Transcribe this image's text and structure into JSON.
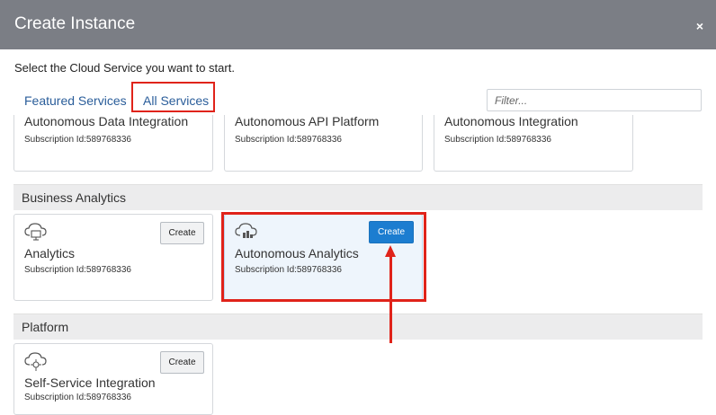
{
  "dialog": {
    "title": "Create Instance",
    "close_label": "×",
    "instruction": "Select the Cloud Service you want to start."
  },
  "tabs": [
    {
      "label": "Featured Services",
      "active": false
    },
    {
      "label": "All Services",
      "active": true
    }
  ],
  "filter": {
    "placeholder": "Filter...",
    "value": ""
  },
  "top_row": [
    {
      "name": "Autonomous Data Integration",
      "subscription": "Subscription Id:589768336"
    },
    {
      "name": "Autonomous API Platform",
      "subscription": "Subscription Id:589768336"
    },
    {
      "name": "Autonomous Integration",
      "subscription": "Subscription Id:589768336"
    }
  ],
  "sections": [
    {
      "title": "Business Analytics",
      "services": [
        {
          "name": "Analytics",
          "subscription": "Subscription Id:589768336",
          "button": "Create",
          "icon": "cloud-monitor-icon"
        },
        {
          "name": "Autonomous Analytics",
          "subscription": "Subscription Id:589768336",
          "button": "Create",
          "icon": "cloud-analytics-icon",
          "highlighted": true
        }
      ]
    },
    {
      "title": "Platform",
      "services": [
        {
          "name": "Self-Service Integration",
          "subscription": "Subscription Id:589768336",
          "button": "Create",
          "icon": "cloud-integration-icon"
        }
      ]
    }
  ],
  "colors": {
    "header_bg": "#7b7e85",
    "link": "#2a5d9a",
    "primary_button": "#1c7dd0",
    "annotation": "#e0231a",
    "section_bg": "#ececed"
  }
}
